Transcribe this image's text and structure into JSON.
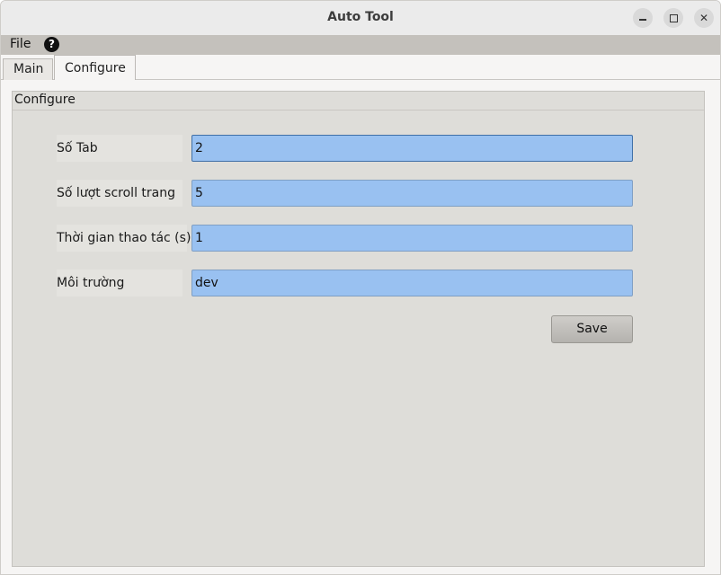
{
  "window": {
    "title": "Auto Tool"
  },
  "menu": {
    "file_label": "File",
    "help_symbol": "?"
  },
  "tabs": [
    {
      "label": "Main"
    },
    {
      "label": "Configure",
      "active": true
    }
  ],
  "configure": {
    "group_title": "Configure",
    "fields": [
      {
        "label": "Số Tab",
        "value": "2"
      },
      {
        "label": "Số lượt scroll trang",
        "value": "5"
      },
      {
        "label": "Thời gian thao tác (s)",
        "value": "1"
      },
      {
        "label": "Môi trường",
        "value": "dev"
      }
    ],
    "save_label": "Save"
  },
  "colors": {
    "input_bg": "#99c1f1",
    "groupbox_bg": "#deddd9",
    "menubar_bg": "#c4c1bc"
  },
  "icons": [
    "minimize-icon",
    "maximize-icon",
    "close-icon",
    "help-icon"
  ]
}
